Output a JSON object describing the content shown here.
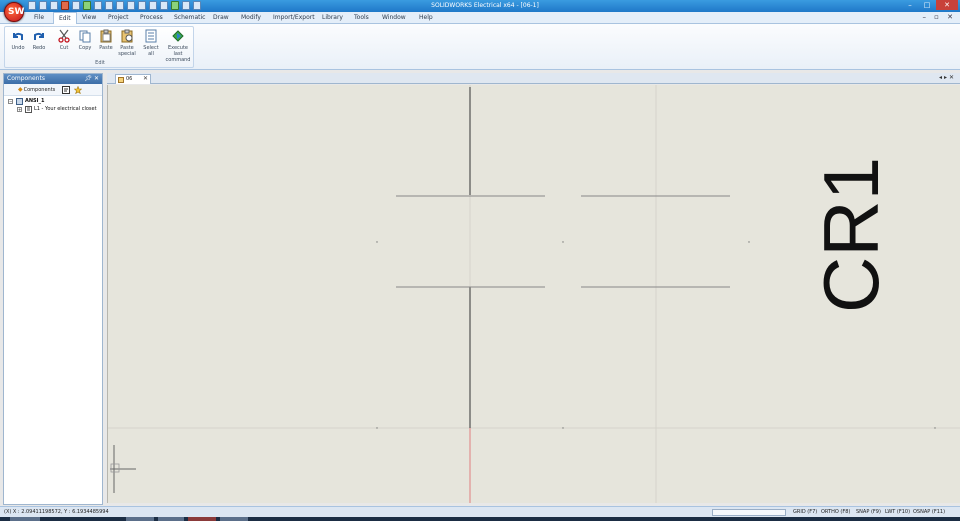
{
  "app": {
    "title": "SOLIDWORKS Electrical x64 - [06-1]",
    "logo_text": "SW"
  },
  "menu": {
    "items": [
      "File",
      "Edit",
      "View",
      "Project",
      "Process",
      "Schematic",
      "Draw",
      "Modify",
      "Import/Export",
      "Library",
      "Tools",
      "Window",
      "Help"
    ],
    "active": "Edit"
  },
  "ribbon": {
    "group_label": "Edit",
    "buttons": {
      "undo": "Undo",
      "redo": "Redo",
      "cut": "Cut",
      "copy": "Copy",
      "paste": "Paste",
      "paste_special": "Paste special",
      "select_all": "Select all",
      "execute_last": "Execute last command"
    }
  },
  "components_panel": {
    "title": "Components",
    "toolbar_label": "Components",
    "tree": [
      {
        "label": "ANSI_1",
        "level": 0
      },
      {
        "label": "L1 - Your electrical closet",
        "level": 1
      }
    ]
  },
  "document": {
    "tab_label": "06"
  },
  "drawing": {
    "component_label": "CR1"
  },
  "status": {
    "coordinates": "(X) X : 2.09411198572, Y : 6.1934485994",
    "toggles": [
      "GRID (F7)",
      "ORTHO (F8)",
      "SNAP (F9)",
      "LWT (F10)",
      "OSNAP (F11)"
    ]
  },
  "colors": {
    "titlebar": "#1f78c8",
    "canvas_background": "#e6e5dc",
    "accent_red": "#c1121c"
  }
}
